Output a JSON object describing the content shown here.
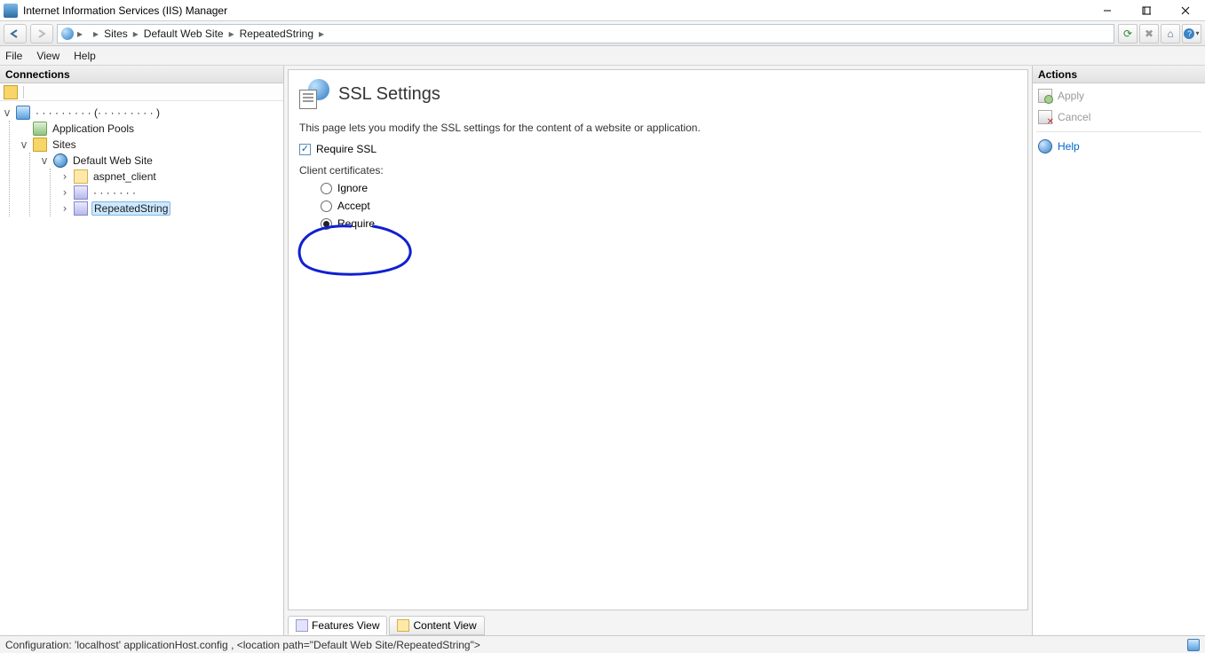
{
  "window": {
    "title": "Internet Information Services (IIS) Manager"
  },
  "breadcrumb": {
    "machine": "",
    "sites": "Sites",
    "site": "Default Web Site",
    "app": "RepeatedString"
  },
  "menu": {
    "file": "File",
    "view": "View",
    "help": "Help"
  },
  "panels": {
    "connections": "Connections",
    "actions": "Actions"
  },
  "tree": {
    "pools": "Application Pools",
    "sites": "Sites",
    "site": "Default Web Site",
    "aspnet": "aspnet_client",
    "app": "RepeatedString"
  },
  "page": {
    "title": "SSL Settings",
    "desc": "This page lets you modify the SSL settings for the content of a website or application.",
    "require_ssl": "Require SSL",
    "client_certs_label": "Client certificates:",
    "radios": {
      "ignore": "Ignore",
      "accept": "Accept",
      "require": "Require"
    }
  },
  "tabs": {
    "features": "Features View",
    "content": "Content View"
  },
  "actions": {
    "apply": "Apply",
    "cancel": "Cancel",
    "help": "Help"
  },
  "status": {
    "text": "Configuration: 'localhost' applicationHost.config , <location path=\"Default Web Site/RepeatedString\">"
  }
}
